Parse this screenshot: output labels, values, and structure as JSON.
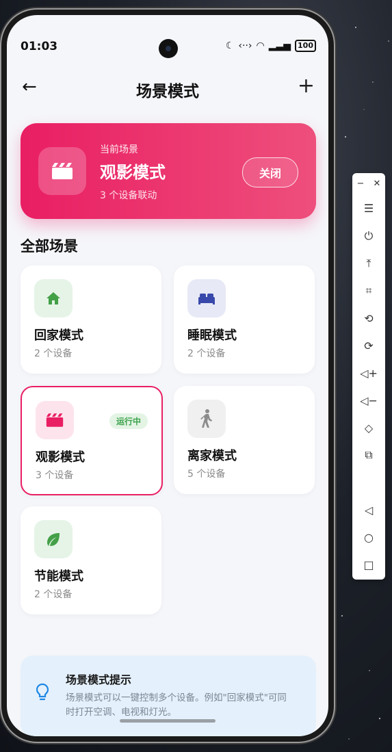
{
  "status_bar": {
    "time": "01:03",
    "battery": "100"
  },
  "header": {
    "title": "场景模式"
  },
  "current_scene": {
    "subtitle": "当前场景",
    "title": "观影模式",
    "device_count": "3 个设备联动",
    "close_label": "关闭"
  },
  "section_title": "全部场景",
  "scenes": [
    {
      "name": "回家模式",
      "count": "2 个设备",
      "icon": "home-icon",
      "color": "#43a047",
      "bg": "#e6f4e8"
    },
    {
      "name": "睡眠模式",
      "count": "2 个设备",
      "icon": "bed-icon",
      "color": "#3949ab",
      "bg": "#e7e9f6"
    },
    {
      "name": "观影模式",
      "count": "3 个设备",
      "icon": "movie-icon",
      "color": "#e91e63",
      "bg": "#fde4ec",
      "badge": "运行中",
      "active": true
    },
    {
      "name": "离家模式",
      "count": "5 个设备",
      "icon": "walk-icon",
      "color": "#8c8c8c",
      "bg": "#f0f0f0"
    },
    {
      "name": "节能模式",
      "count": "2 个设备",
      "icon": "leaf-icon",
      "color": "#43a047",
      "bg": "#e6f4e8"
    }
  ],
  "tip": {
    "title": "场景模式提示",
    "text": "场景模式可以一键控制多个设备。例如\"回家模式\"可同时打开空调、电视和灯光。"
  },
  "colors": {
    "accent": "#e91e63",
    "running": "#3aa14a"
  }
}
